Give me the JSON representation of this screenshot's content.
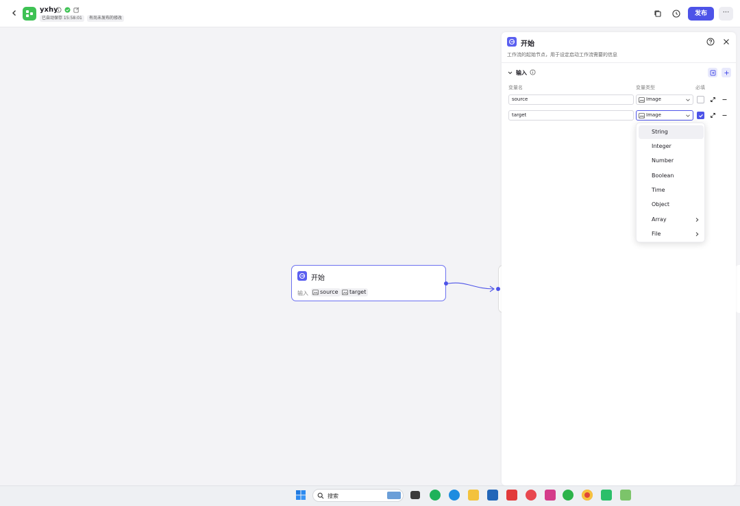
{
  "header": {
    "app_name": "yxhy",
    "autosave_text": "已自动保存 15:58:01",
    "change_text": "有尚未发布的修改",
    "publish_label": "发布",
    "more_label": "···"
  },
  "canvas": {
    "node": {
      "title": "开始",
      "input_label": "输入",
      "chips": [
        "source",
        "target"
      ]
    }
  },
  "panel": {
    "title": "开始",
    "description": "工作流的起始节点，用于设定启动工作流需要的信息",
    "section_title": "输入",
    "col_name": "变量名",
    "col_type": "变量类型",
    "col_required": "必填",
    "rows": [
      {
        "name": "source",
        "type": "Image",
        "required": false
      },
      {
        "name": "target",
        "type": "Image",
        "required": true
      }
    ]
  },
  "dropdown": {
    "options": [
      "String",
      "Integer",
      "Number",
      "Boolean",
      "Time",
      "Object",
      "Array",
      "File"
    ]
  },
  "taskbar": {
    "search_label": "搜索"
  },
  "colors": {
    "accent": "#4d53e8",
    "app_logo": "#3ec254"
  }
}
